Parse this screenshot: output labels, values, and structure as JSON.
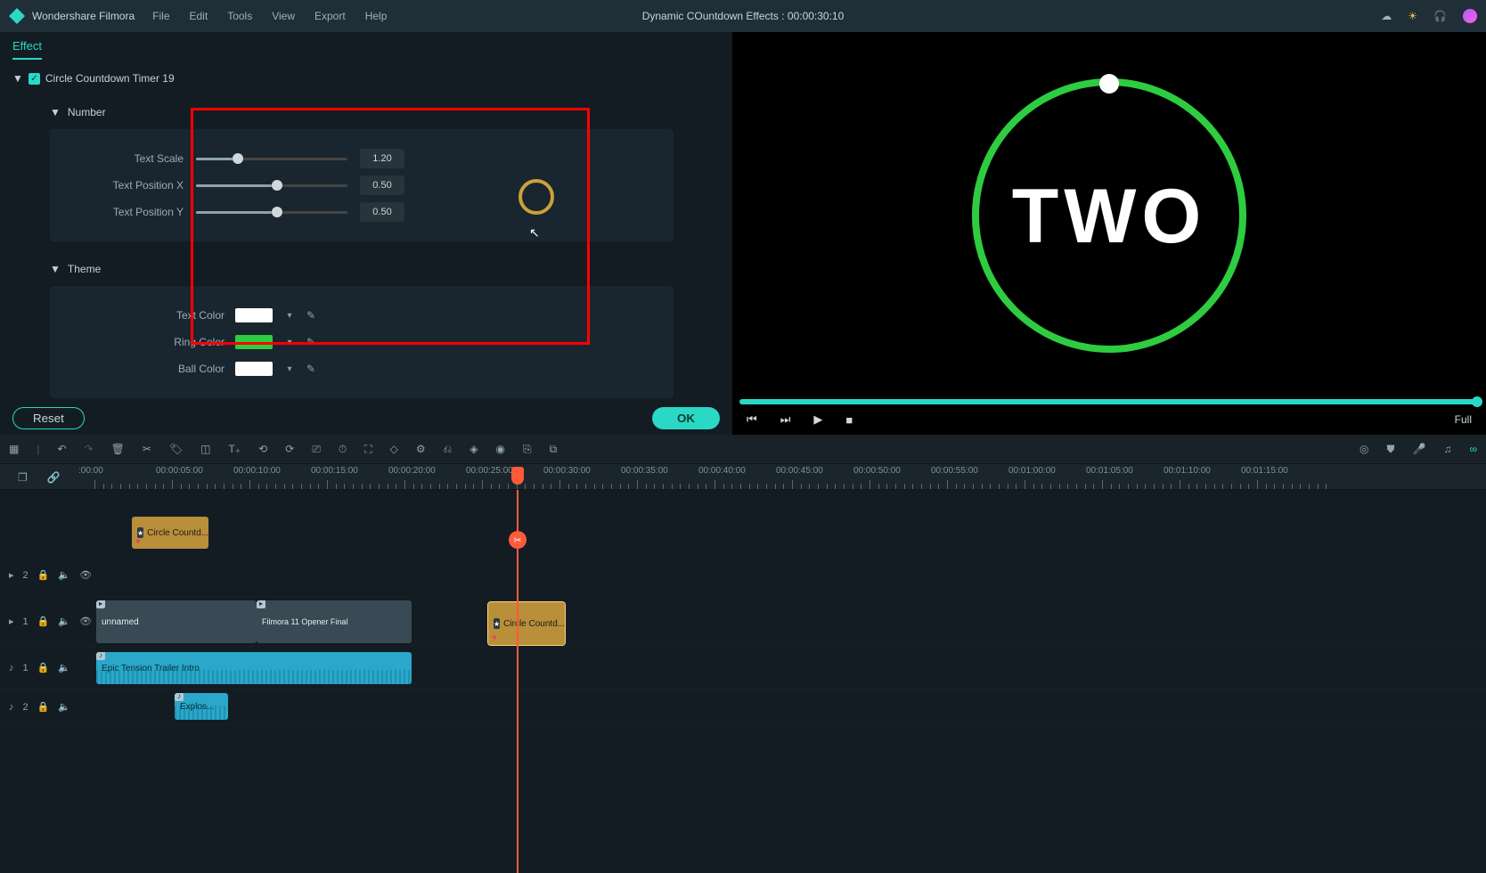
{
  "titlebar": {
    "app_name": "Wondershare Filmora",
    "menus": [
      "File",
      "Edit",
      "Tools",
      "View",
      "Export",
      "Help"
    ],
    "center": "Dynamic COuntdown Effects : 00:00:30:10"
  },
  "effect_panel": {
    "tab": "Effect",
    "item_name": "Circle Countdown Timer 19",
    "section_number": "Number",
    "section_theme": "Theme",
    "sliders": {
      "text_scale": {
        "label": "Text Scale",
        "value": "1.20",
        "pct": 24
      },
      "text_pos_x": {
        "label": "Text Position X",
        "value": "0.50",
        "pct": 50
      },
      "text_pos_y": {
        "label": "Text Position Y",
        "value": "0.50",
        "pct": 50
      }
    },
    "colors": {
      "text": {
        "label": "Text Color",
        "hex": "#ffffff"
      },
      "ring": {
        "label": "Ring Color",
        "hex": "#2ecc40"
      },
      "ball": {
        "label": "Ball Color",
        "hex": "#ffffff"
      }
    },
    "reset": "Reset",
    "ok": "OK"
  },
  "preview": {
    "big_text": "TWO",
    "full_label": "Full"
  },
  "ruler": {
    "ticks": [
      ":00:00",
      "00:00:05:00",
      "00:00:10:00",
      "00:00:15:00",
      "00:00:20:00",
      "00:00:25:00",
      "00:00:30:00",
      "00:00:35:00",
      "00:00:40:00",
      "00:00:45:00",
      "00:00:50:00",
      "00:00:55:00",
      "00:01:00:00",
      "00:01:05:00",
      "00:01:10:00",
      "00:01:15:00"
    ]
  },
  "tracks": {
    "v2": "2",
    "v1": "1",
    "a1": "1",
    "a2": "2",
    "clip_effect1": "Circle Countd...",
    "clip_effect2": "Circle Countd...",
    "clip_unnamed": "unnamed",
    "clip_opener": "Filmora 11 Opener Final",
    "clip_audio1": "Epic Tension Trailer Intro",
    "clip_audio2": "Explos..."
  }
}
